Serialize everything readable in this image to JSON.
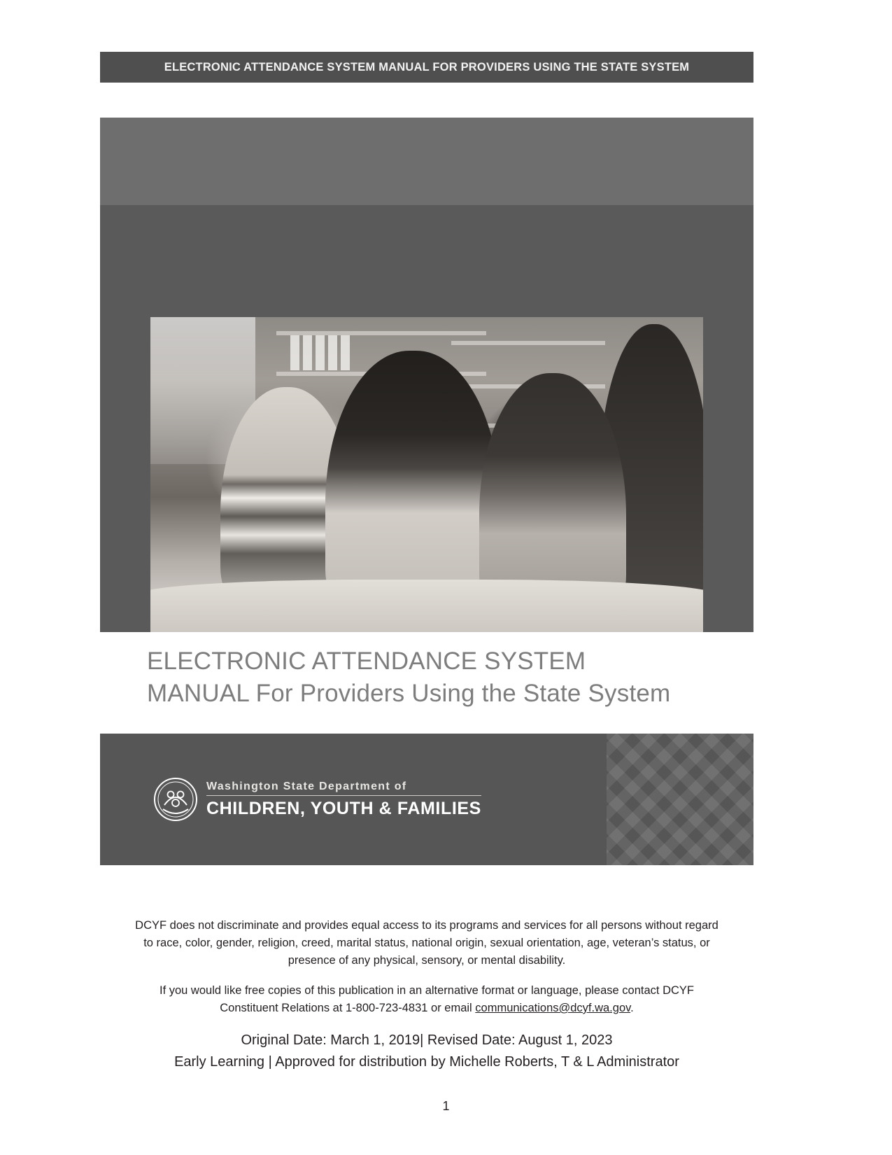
{
  "document": {
    "running_header": "ELECTRONIC ATTENDANCE SYSTEM MANUAL FOR PROVIDERS USING THE STATE SYSTEM",
    "page_number": "1"
  },
  "cover": {
    "title_line_1": "ELECTRONIC ATTENDANCE SYSTEM",
    "title_line_2": "MANUAL For Providers Using the State System",
    "photo_alt": "Adult caregiver seated at a table with two young children doing an art activity"
  },
  "brand": {
    "seal_icon": "dcyf-seal-icon",
    "agency_prefix": "Washington State Department of",
    "agency_name": "CHILDREN, YOUTH & FAMILIES"
  },
  "legal": {
    "nondiscrimination_line_1": "DCYF does not discriminate and provides equal access to its programs and services for all persons without regard",
    "nondiscrimination_line_2": "to race, color, gender, religion, creed, marital status, national origin, sexual orientation, age, veteran’s status, or",
    "nondiscrimination_line_3": "presence of any physical, sensory, or mental disability.",
    "alt_format_line_1": "If you would like free copies of this publication in an alternative format or language, please contact DCYF",
    "alt_format_line_2_prefix": "Constituent Relations at 1-800-723-4831 or email ",
    "alt_format_email": "communications@dcyf.wa.gov",
    "alt_format_line_2_suffix": ".",
    "dates_line": "Original Date: March 1, 2019| Revised Date: August 1, 2023",
    "approval_line": "Early Learning | Approved for distribution by Michelle Roberts, T & L Administrator"
  },
  "colors": {
    "header_bar": "#4f4f4f",
    "brand_band": "#565656",
    "photo_surround": "#6e6e6e",
    "title_text": "#7d7d7d",
    "body_text": "#231f20"
  }
}
